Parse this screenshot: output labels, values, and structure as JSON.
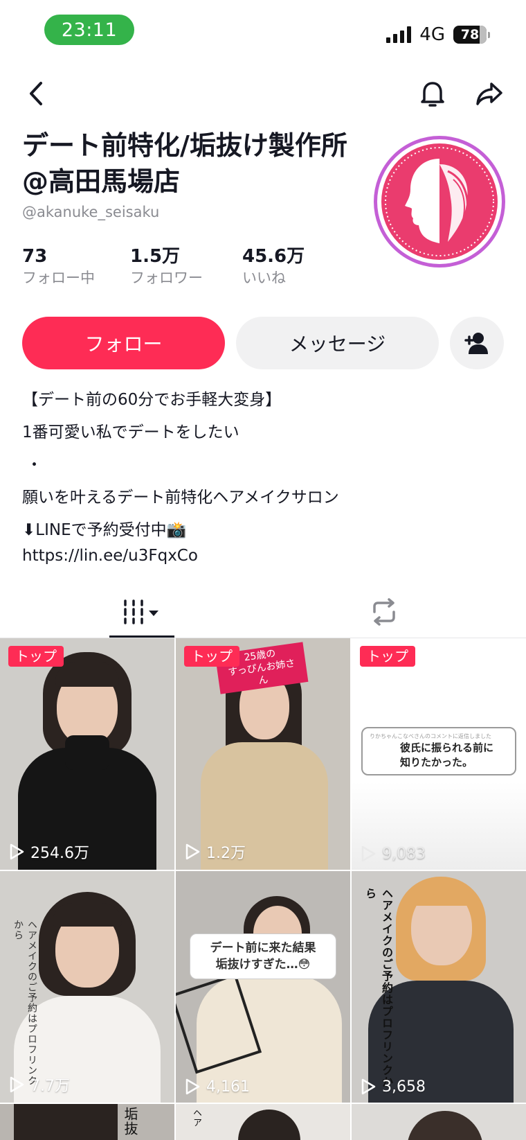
{
  "status_bar": {
    "time": "23:11",
    "network": "4G",
    "battery": "78"
  },
  "nav": {
    "icons": [
      "chevron-left-icon",
      "bell-icon",
      "share-icon"
    ]
  },
  "profile": {
    "name": "デート前特化/垢抜け製作所@高田馬場店",
    "handle": "@akanuke_seisaku",
    "avatar_color": "#ea3c6e",
    "avatar_ring_color": "#c45fd6"
  },
  "stats": [
    {
      "value": "73",
      "label": "フォロー中"
    },
    {
      "value": "1.5万",
      "label": "フォロワー"
    },
    {
      "value": "45.6万",
      "label": "いいね"
    }
  ],
  "actions": {
    "follow": "フォロー",
    "message": "メッセージ",
    "follow_color": "#fe2c55"
  },
  "bio": {
    "lines": [
      "【デート前の60分でお手軽大変身】",
      "1番可愛い私でデートをしたい",
      "・",
      "願いを叶えるデート前特化ヘアメイクサロン",
      "⬇LINEで予約受付中📸"
    ],
    "link": "https://lin.ee/u3FqxCo"
  },
  "tabs": {
    "videos_icon": "grid-columns-icon",
    "reposts_icon": "repost-icon"
  },
  "videos": [
    {
      "badge": "トップ",
      "views": "254.6万"
    },
    {
      "badge": "トップ",
      "views": "1.2万",
      "ribbon": "25歳の\nすっぴんお姉さん"
    },
    {
      "badge": "トップ",
      "views": "9,083",
      "comment_header": "りかちゃんこなべさんのコメントに返信しました",
      "comment": "彼氏に振られる前に\n知りたかった。"
    },
    {
      "views": "7.7万",
      "side_text": "ヘアメイクのご予約はプロフリンクから"
    },
    {
      "views": "4,161",
      "caption": "デート前に来た結果\n垢抜けすぎた…😳"
    },
    {
      "views": "3,658",
      "side_text": "ヘアメイクのご予約はプロフリンクから"
    }
  ],
  "partial_row": {
    "cell1_text": "垢抜",
    "cell2_text": "ヘア"
  }
}
